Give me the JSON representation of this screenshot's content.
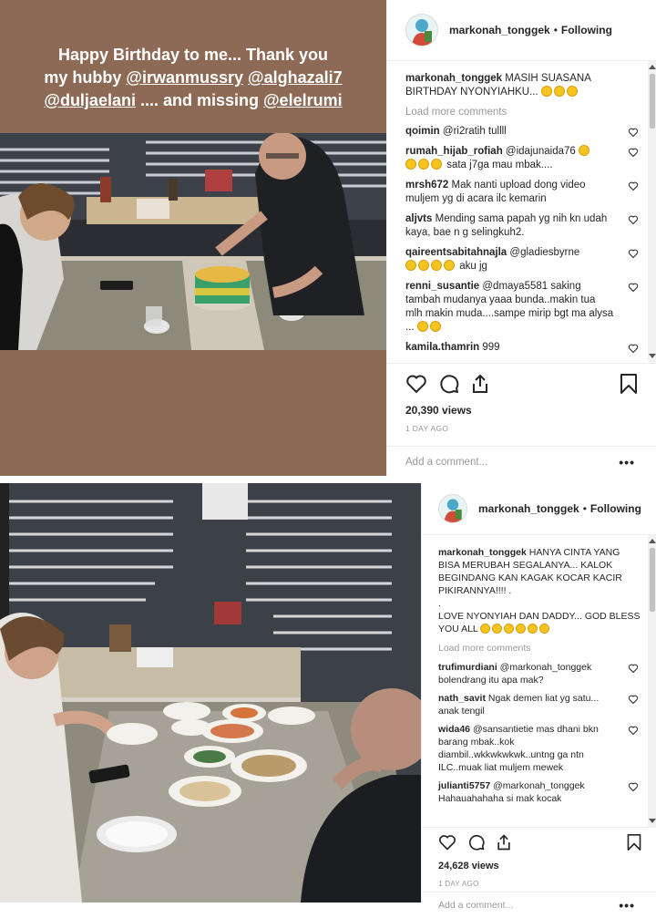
{
  "post1": {
    "story_text": [
      "Happy Birthday to me... Thank you",
      "my hubby ",
      "@irwanmussry",
      " ",
      "@alghazali7",
      "@duljaelani",
      " .... and missing ",
      "@elelrumi"
    ],
    "username": "markonah_tonggek",
    "dot": "•",
    "follow_label": "Following",
    "caption_user": "markonah_tonggek",
    "caption_text": "MASIH SUASANA BIRTHDAY NYONYIAHKU...",
    "caption_emoji_count": 3,
    "load_more": "Load more comments",
    "comments": [
      {
        "user": "qoimin",
        "text": "@ri2ratih tullll",
        "emoji": 0
      },
      {
        "user": "rumah_hijab_rofiah",
        "text": "@idajunaida76",
        "emoji_after_mention": 1,
        "text2": "sata j7ga mau mbak....",
        "emoji": 3
      },
      {
        "user": "mrsh672",
        "text": "Mak nanti upload dong video muljem yg di acara ilc kemarin",
        "emoji": 0
      },
      {
        "user": "aljvts",
        "text": "Mending sama papah yg nih kn udah kaya, bae n g selingkuh2.",
        "emoji": 0
      },
      {
        "user": "qaireentsabitahnajla",
        "text": "@gladiesbyrne",
        "text2": "aku jg",
        "emoji": 4
      },
      {
        "user": "renni_susantie",
        "text": "@dmaya5581 saking tambah mudanya yaaa bunda..makin tua mlh makin muda....sampe mirip bgt ma alysa ...",
        "emoji": 2
      },
      {
        "user": "kamila.thamrin",
        "text": "999",
        "emoji": 0
      }
    ],
    "views": "20,390 views",
    "time_ago": "1 DAY AGO",
    "add_comment": "Add a comment...",
    "more": "•••"
  },
  "post2": {
    "username": "markonah_tonggek",
    "dot": "•",
    "follow_label": "Following",
    "caption_user": "markonah_tonggek",
    "caption_text": "HANYA CINTA YANG BISA MERUBAH SEGALANYA... KALOK BEGINDANG KAN KAGAK KOCAR KACIR PIKIRANNYA!!!! .",
    "caption_dot": ".",
    "caption_text2": "LOVE NYONYIAH DAN DADDY... GOD BLESS YOU ALL",
    "caption_emoji_count": 6,
    "load_more": "Load more comments",
    "comments": [
      {
        "user": "trufimurdiani",
        "text": "@markonah_tonggek bolendrang itu apa mak?"
      },
      {
        "user": "nath_savit",
        "text": "Ngak demen liat yg satu... anak tengil"
      },
      {
        "user": "wida46",
        "text": "@sansantietie mas dhani bkn barang mbak..kok diambil..wkkwkwkwk..untng ga ntn ILC..muak liat muljem mewek"
      },
      {
        "user": "julianti5757",
        "text": "@markonah_tonggek Hahauahahaha si mak kocak"
      }
    ],
    "views": "24,628 views",
    "time_ago": "1 DAY AGO",
    "add_comment": "Add a comment...",
    "more": "•••"
  }
}
